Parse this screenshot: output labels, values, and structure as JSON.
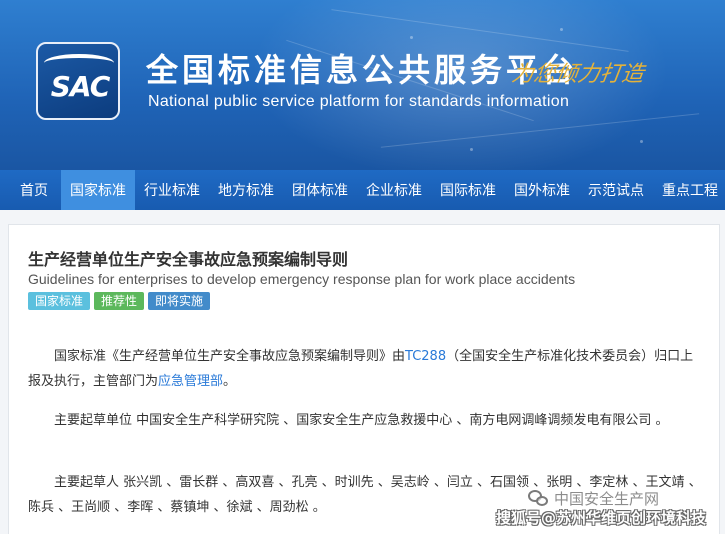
{
  "header": {
    "logo_text": "SAC",
    "title_cn": "全国标准信息公共服务平台",
    "title_en": "National public service platform  for standards information",
    "slogan": "为您倾力打造"
  },
  "nav": {
    "items": [
      {
        "label": "首页",
        "active": false
      },
      {
        "label": "国家标准",
        "active": true
      },
      {
        "label": "行业标准",
        "active": false
      },
      {
        "label": "地方标准",
        "active": false
      },
      {
        "label": "团体标准",
        "active": false
      },
      {
        "label": "企业标准",
        "active": false
      },
      {
        "label": "国际标准",
        "active": false
      },
      {
        "label": "国外标准",
        "active": false
      },
      {
        "label": "示范试点",
        "active": false
      },
      {
        "label": "重点工程",
        "active": false
      }
    ]
  },
  "standard": {
    "title_cn": "生产经营单位生产安全事故应急预案编制导则",
    "title_en": "Guidelines for enterprises to develop emergency response plan for work place accidents",
    "badges": [
      {
        "label": "国家标准",
        "color": "#5bc0de"
      },
      {
        "label": "推荐性",
        "color": "#5cb85c"
      },
      {
        "label": "即将实施",
        "color": "#428bca"
      }
    ],
    "para1": {
      "prefix": "国家标准《生产经营单位生产安全事故应急预案编制导则》由",
      "tc_link": "TC288",
      "middle": "（全国安全生产标准化技术委员会）归口上报及执行，主管部门为",
      "dept_link": "应急管理部",
      "suffix": "。"
    },
    "para2": "主要起草单位 中国安全生产科学研究院 、国家安全生产应急救援中心 、南方电网调峰调频发电有限公司 。",
    "para3": "主要起草人 张兴凯 、雷长群 、高双喜 、孔亮 、时训先 、吴志岭 、闫立 、石国领 、张明 、李定林 、王文靖 、陈兵 、王尚顺 、李晖 、蔡镇坤 、徐斌 、周劲松 。"
  },
  "watermarks": {
    "wechat": "中国安全生产网",
    "sohu": "搜狐号@苏州华维页创环境科技"
  },
  "colors": {
    "banner": "#1f63b6",
    "nav": "#1f6ac4",
    "nav_active": "#3f8fe0",
    "link": "#2a7ad8"
  }
}
